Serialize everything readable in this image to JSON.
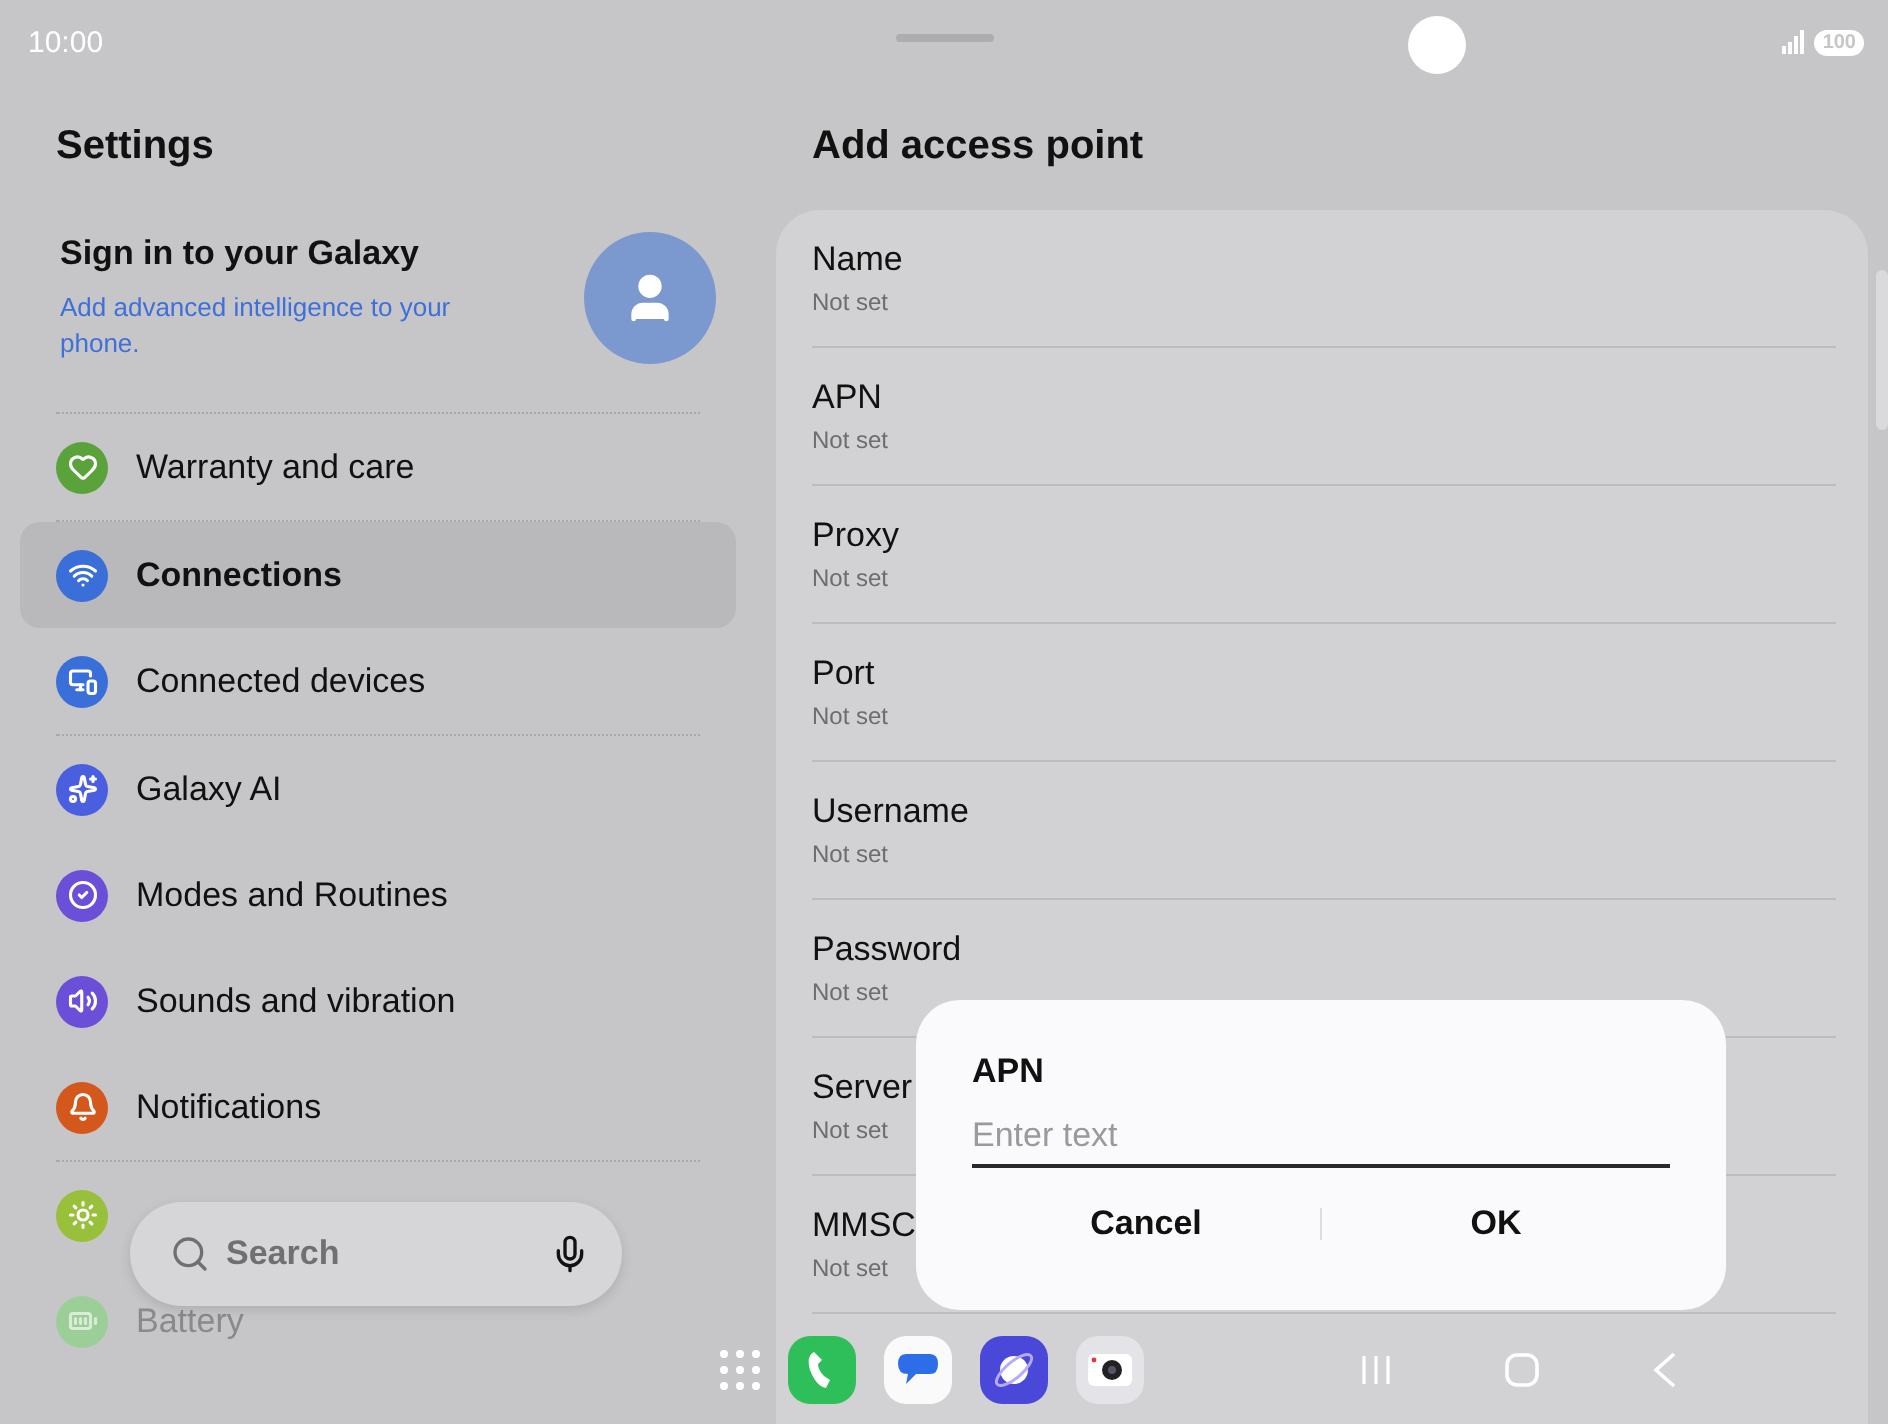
{
  "status_bar": {
    "time": "10:00",
    "battery": "100"
  },
  "sidebar": {
    "title": "Settings",
    "account": {
      "title": "Sign in to your Galaxy",
      "subtitle": "Add advanced intelligence to your phone."
    },
    "groups": [
      [
        {
          "label": "Warranty and care",
          "color": "#5aa33a",
          "selected": false,
          "faded": false
        }
      ],
      [
        {
          "label": "Connections",
          "color": "#3a6ed8",
          "selected": true,
          "faded": false
        },
        {
          "label": "Connected devices",
          "color": "#3a6ed8",
          "selected": false,
          "faded": false
        }
      ],
      [
        {
          "label": "Galaxy AI",
          "color": "#4a5ee0",
          "selected": false,
          "faded": false
        },
        {
          "label": "Modes and Routines",
          "color": "#6b4fd8",
          "selected": false,
          "faded": false
        },
        {
          "label": "Sounds and vibration",
          "color": "#6b4fd8",
          "selected": false,
          "faded": false
        },
        {
          "label": "Notifications",
          "color": "#d4581c",
          "selected": false,
          "faded": false
        }
      ],
      [
        {
          "color": "#98c03a",
          "selected": false,
          "faded": false
        },
        {
          "label": "Battery",
          "color": "#9ccf98",
          "selected": false,
          "faded": true
        }
      ]
    ]
  },
  "search": {
    "placeholder": "Search"
  },
  "panel": {
    "title": "Add access point",
    "rows": [
      {
        "label": "Name",
        "value": "Not set"
      },
      {
        "label": "APN",
        "value": "Not set"
      },
      {
        "label": "Proxy",
        "value": "Not set"
      },
      {
        "label": "Port",
        "value": "Not set"
      },
      {
        "label": "Username",
        "value": "Not set"
      },
      {
        "label": "Password",
        "value": "Not set"
      },
      {
        "label": "Server",
        "value": "Not set"
      },
      {
        "label": "MMSC",
        "value": "Not set"
      }
    ]
  },
  "dialog": {
    "title": "APN",
    "placeholder": "Enter text",
    "buttons": [
      "Cancel",
      "OK"
    ]
  }
}
